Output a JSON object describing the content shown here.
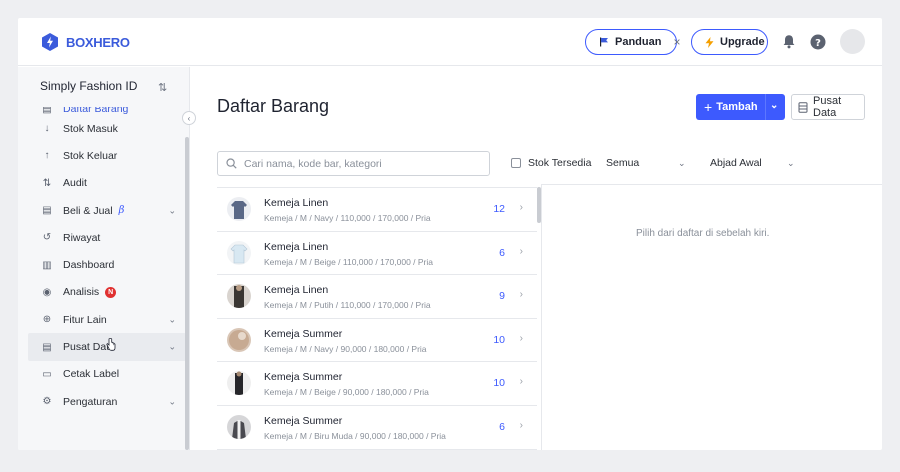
{
  "header": {
    "brand": "BOXHERO",
    "guide_label": "Panduan",
    "guide_close": "×",
    "upgrade_label": "Upgrade"
  },
  "sidebar": {
    "store_name": "Simply Fashion ID",
    "sort_glyph": "⇅",
    "collapse_glyph": "‹",
    "items": [
      {
        "label": "Daftar Barang",
        "icon": "list-icon",
        "glyph": "▤",
        "chevron": false
      },
      {
        "label": "Stok Masuk",
        "icon": "arrow-down-icon",
        "glyph": "↓",
        "chevron": false
      },
      {
        "label": "Stok Keluar",
        "icon": "arrow-up-icon",
        "glyph": "↑",
        "chevron": false
      },
      {
        "label": "Audit",
        "icon": "swap-icon",
        "glyph": "⇅",
        "chevron": false
      },
      {
        "label": "Beli & Jual",
        "icon": "document-icon",
        "glyph": "▤",
        "chevron": true,
        "beta": "β"
      },
      {
        "label": "Riwayat",
        "icon": "history-icon",
        "glyph": "↺",
        "chevron": false
      },
      {
        "label": "Dashboard",
        "icon": "bar-chart-icon",
        "glyph": "▥",
        "chevron": false
      },
      {
        "label": "Analisis",
        "icon": "eye-icon",
        "glyph": "◉",
        "chevron": false,
        "badge": "N"
      },
      {
        "label": "Fitur Lain",
        "icon": "plus-circle-icon",
        "glyph": "⊕",
        "chevron": true
      },
      {
        "label": "Pusat Data",
        "icon": "database-icon",
        "glyph": "▤",
        "chevron": true,
        "active": true
      },
      {
        "label": "Cetak Label",
        "icon": "label-icon",
        "glyph": "▭",
        "chevron": false
      },
      {
        "label": "Pengaturan",
        "icon": "gear-icon",
        "glyph": "⚙",
        "chevron": true
      }
    ]
  },
  "main": {
    "title": "Daftar Barang",
    "add_label": "Tambah",
    "data_center_label": "Pusat Data",
    "search_placeholder": "Cari nama, kode bar, kategori",
    "stock_checkbox_label": "Stok Tersedia",
    "filter_all": "Semua",
    "sort_label": "Abjad Awal",
    "empty_message": "Pilih dari daftar di sebelah kiri.",
    "products": [
      {
        "name": "Kemeja Linen",
        "detail": "Kemeja / M / Navy / 110,000 / 170,000 / Pria",
        "qty": "12",
        "thumb": "#5a6886"
      },
      {
        "name": "Kemeja Linen",
        "detail": "Kemeja / M / Beige / 110,000 / 170,000 / Pria",
        "qty": "6",
        "thumb": "#d8e8f2"
      },
      {
        "name": "Kemeja Linen",
        "detail": "Kemeja / M / Putih / 110,000 / 170,000 / Pria",
        "qty": "9",
        "thumb": "#3a3633"
      },
      {
        "name": "Kemeja Summer",
        "detail": "Kemeja / M / Navy / 90,000 / 180,000 / Pria",
        "qty": "10",
        "thumb": "#c7aa92"
      },
      {
        "name": "Kemeja Summer",
        "detail": "Kemeja / M / Beige / 90,000 / 180,000 / Pria",
        "qty": "10",
        "thumb": "#26262a"
      },
      {
        "name": "Kemeja Summer",
        "detail": "Kemeja / M / Biru Muda / 90,000 / 180,000 / Pria",
        "qty": "6",
        "thumb": "#4a4a50"
      }
    ]
  },
  "colors": {
    "accent": "#3d5afe",
    "quantity": "#3d5afe",
    "badge": "#e03131"
  }
}
